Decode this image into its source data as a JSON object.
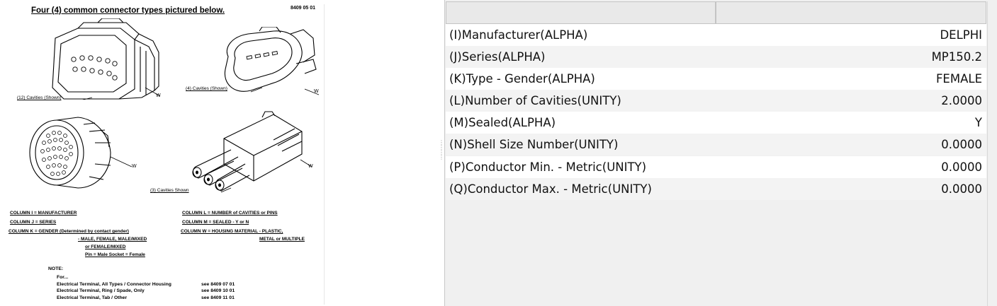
{
  "document": {
    "title": "Four (4)  common  connector types  pictured  below.",
    "doc_number": "8409 05 01",
    "captions": {
      "c12": "(12) Cavities (Shown)",
      "c4": "(4) Cavities (Shown)",
      "c3": "(3) Cavities Shown",
      "w": "W"
    },
    "legend": {
      "col_i": "COLUMN  I  =  MANUFACTURER",
      "col_j": "COLUMN  J  =  SERIES",
      "col_k": "COLUMN  K  =  GENDER (Determined by contact gender)",
      "col_k2": "-  MALE,  FEMALE,  MALE/MIXED",
      "col_k3": "or FEMALE/MIXED",
      "col_k4": "Pin = Male  Socket = Female",
      "col_l": "COLUMN  L  =  NUMBER  of  CAVITIES  or  PINS",
      "col_m": "COLUMN  M  =  SEALED  -   Y or N",
      "col_w": "COLUMN  W  =  HOUSING  MATERIAL  -  PLASTIC,",
      "col_w2": "METAL  or  MULTIPLE"
    },
    "note": {
      "label": "NOTE:",
      "for": "For...",
      "lines": [
        {
          "text": "Electrical Terminal, All Types / Connector Housing",
          "ref": "see  8409 07 01"
        },
        {
          "text": "Electrical Terminal, Ring / Spade, Only",
          "ref": "see  8409 10 01"
        },
        {
          "text": "Electrical Terminal, Tab / Other",
          "ref": "see  8409 11 01"
        }
      ]
    }
  },
  "properties": [
    {
      "label": "(I)Manufacturer(ALPHA)",
      "value": "DELPHI"
    },
    {
      "label": "(J)Series(ALPHA)",
      "value": "MP150.2"
    },
    {
      "label": "(K)Type - Gender(ALPHA)",
      "value": "FEMALE"
    },
    {
      "label": "(L)Number of Cavities(UNITY)",
      "value": "2.0000"
    },
    {
      "label": "(M)Sealed(ALPHA)",
      "value": "Y"
    },
    {
      "label": "(N)Shell Size Number(UNITY)",
      "value": "0.0000"
    },
    {
      "label": "(P)Conductor Min. - Metric(UNITY)",
      "value": "0.0000"
    },
    {
      "label": "(Q)Conductor Max. - Metric(UNITY)",
      "value": "0.0000"
    }
  ]
}
